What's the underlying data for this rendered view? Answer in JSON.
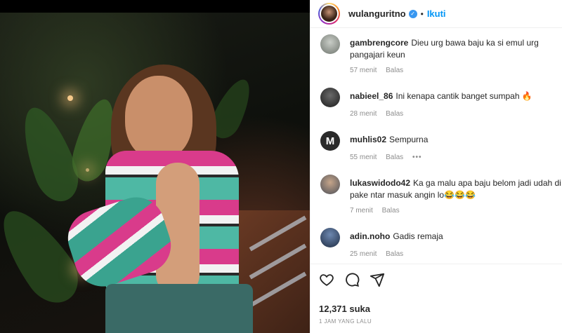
{
  "post": {
    "username": "wulanguritno",
    "follow_label": "Ikuti",
    "separator": "•",
    "verified_icon": "✓"
  },
  "comments": [
    {
      "user": "gambrengcore",
      "text": "Dieu urg bawa baju ka si emul urg pangajari keun",
      "time": "57 menit",
      "reply": "Balas",
      "avatar_color": "#9aa39a"
    },
    {
      "user": "nabieel_86",
      "text": "Ini kenapa cantik banget sumpah 🔥",
      "time": "28 menit",
      "reply": "Balas",
      "avatar_color": "#3b3b3b"
    },
    {
      "user": "muhlis02",
      "text": "Sempurna",
      "time": "55 menit",
      "reply": "Balas",
      "more": "•••",
      "avatar_letter": "M",
      "avatar_color": "#2a2a2a"
    },
    {
      "user": "lukaswidodo42",
      "text": "Ka ga malu apa baju belom jadi udah di pake ntar masuk angin lo😂😂😂",
      "time": "7 menit",
      "reply": "Balas",
      "avatar_color": "#7c7f86"
    },
    {
      "user": "adin.noho",
      "text": "Gadis remaja",
      "time": "25 menit",
      "reply": "Balas",
      "avatar_color": "#2d4260"
    }
  ],
  "stats": {
    "likes": "12,371 suka",
    "posted": "1 JAM YANG LALU"
  },
  "icons": [
    "heart-icon",
    "comment-icon",
    "share-icon"
  ]
}
